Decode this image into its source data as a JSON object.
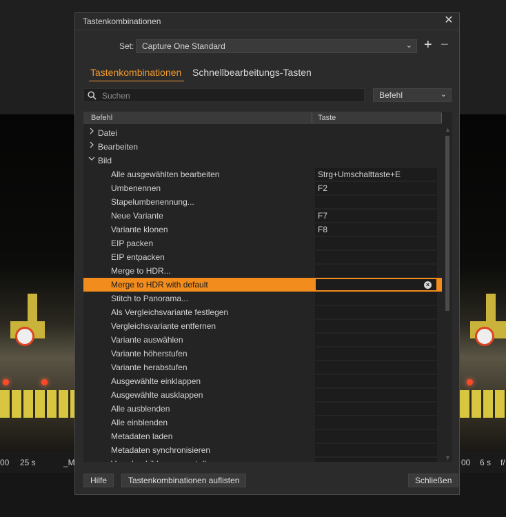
{
  "background": {
    "status_left": [
      "00",
      "25 s",
      "_M"
    ],
    "status_right": [
      "00",
      "6 s",
      "f/"
    ]
  },
  "dialog": {
    "title": "Tastenkombinationen",
    "close_glyph": "✕",
    "set_label": "Set:",
    "set_value": "Capture One Standard",
    "plus": "+",
    "minus": "−",
    "tabs": [
      {
        "label": "Tastenkombinationen",
        "active": true
      },
      {
        "label": "Schnellbearbeitungs-Tasten",
        "active": false
      }
    ],
    "search_placeholder": "Suchen",
    "filter_value": "Befehl",
    "columns": [
      "Befehl",
      "Taste"
    ],
    "rows": [
      {
        "type": "group",
        "label": "Datei",
        "expanded": false
      },
      {
        "type": "group",
        "label": "Bearbeiten",
        "expanded": false
      },
      {
        "type": "group",
        "label": "Bild",
        "expanded": true
      },
      {
        "type": "cmd",
        "label": "Alle ausgewählten bearbeiten",
        "key": "Strg+Umschalttaste+E"
      },
      {
        "type": "cmd",
        "label": "Umbenennen",
        "key": "F2"
      },
      {
        "type": "cmd",
        "label": "Stapelumbenennung...",
        "key": ""
      },
      {
        "type": "cmd",
        "label": "Neue Variante",
        "key": "F7"
      },
      {
        "type": "cmd",
        "label": "Variante klonen",
        "key": "F8"
      },
      {
        "type": "cmd",
        "label": "EIP packen",
        "key": ""
      },
      {
        "type": "cmd",
        "label": "EIP entpacken",
        "key": ""
      },
      {
        "type": "cmd",
        "label": "Merge to HDR...",
        "key": ""
      },
      {
        "type": "cmd",
        "label": "Merge to HDR with default",
        "key": "",
        "selected": true
      },
      {
        "type": "cmd",
        "label": "Stitch to Panorama...",
        "key": ""
      },
      {
        "type": "cmd",
        "label": "Als Vergleichsvariante festlegen",
        "key": ""
      },
      {
        "type": "cmd",
        "label": "Vergleichsvariante entfernen",
        "key": ""
      },
      {
        "type": "cmd",
        "label": "Variante auswählen",
        "key": ""
      },
      {
        "type": "cmd",
        "label": "Variante höherstufen",
        "key": ""
      },
      {
        "type": "cmd",
        "label": "Variante herabstufen",
        "key": ""
      },
      {
        "type": "cmd",
        "label": "Ausgewählte einklappen",
        "key": ""
      },
      {
        "type": "cmd",
        "label": "Ausgewählte ausklappen",
        "key": ""
      },
      {
        "type": "cmd",
        "label": "Alle ausblenden",
        "key": ""
      },
      {
        "type": "cmd",
        "label": "Alle einblenden",
        "key": ""
      },
      {
        "type": "cmd",
        "label": "Metadaten laden",
        "key": ""
      },
      {
        "type": "cmd",
        "label": "Metadaten synchronisieren",
        "key": ""
      },
      {
        "type": "cmd",
        "label": "Vorschaubilder neu erstellen",
        "key": ""
      }
    ],
    "buttons": {
      "help": "Hilfe",
      "list": "Tastenkombinationen auflisten",
      "close": "Schließen"
    },
    "colors": {
      "accent": "#f39a2c",
      "selected_row": "#f28c1c"
    },
    "icons": {
      "search": "search-icon",
      "collapsed": "chevron-right-icon",
      "expanded": "chevron-down-icon",
      "clear": "clear-circle-icon"
    }
  }
}
